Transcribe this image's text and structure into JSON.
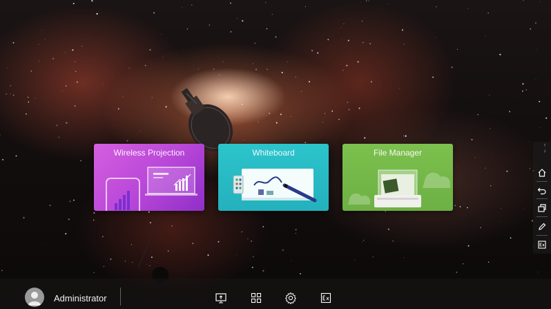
{
  "apps": [
    {
      "label": "Wireless Projection",
      "color": "#c04fdc"
    },
    {
      "label": "Whiteboard",
      "color": "#27b8c4"
    },
    {
      "label": "File Manager",
      "color": "#74b848"
    }
  ],
  "user": {
    "name": "Administrator"
  },
  "taskbar": {
    "icons": [
      "projection-icon",
      "apps-grid-icon",
      "settings-gear-icon",
      "note-icon"
    ]
  },
  "side_bar": {
    "icons": [
      "chevron-left-icon",
      "chevron-right-icon",
      "home-icon",
      "back-icon",
      "recent-windows-icon",
      "pen-icon",
      "note-icon"
    ]
  }
}
